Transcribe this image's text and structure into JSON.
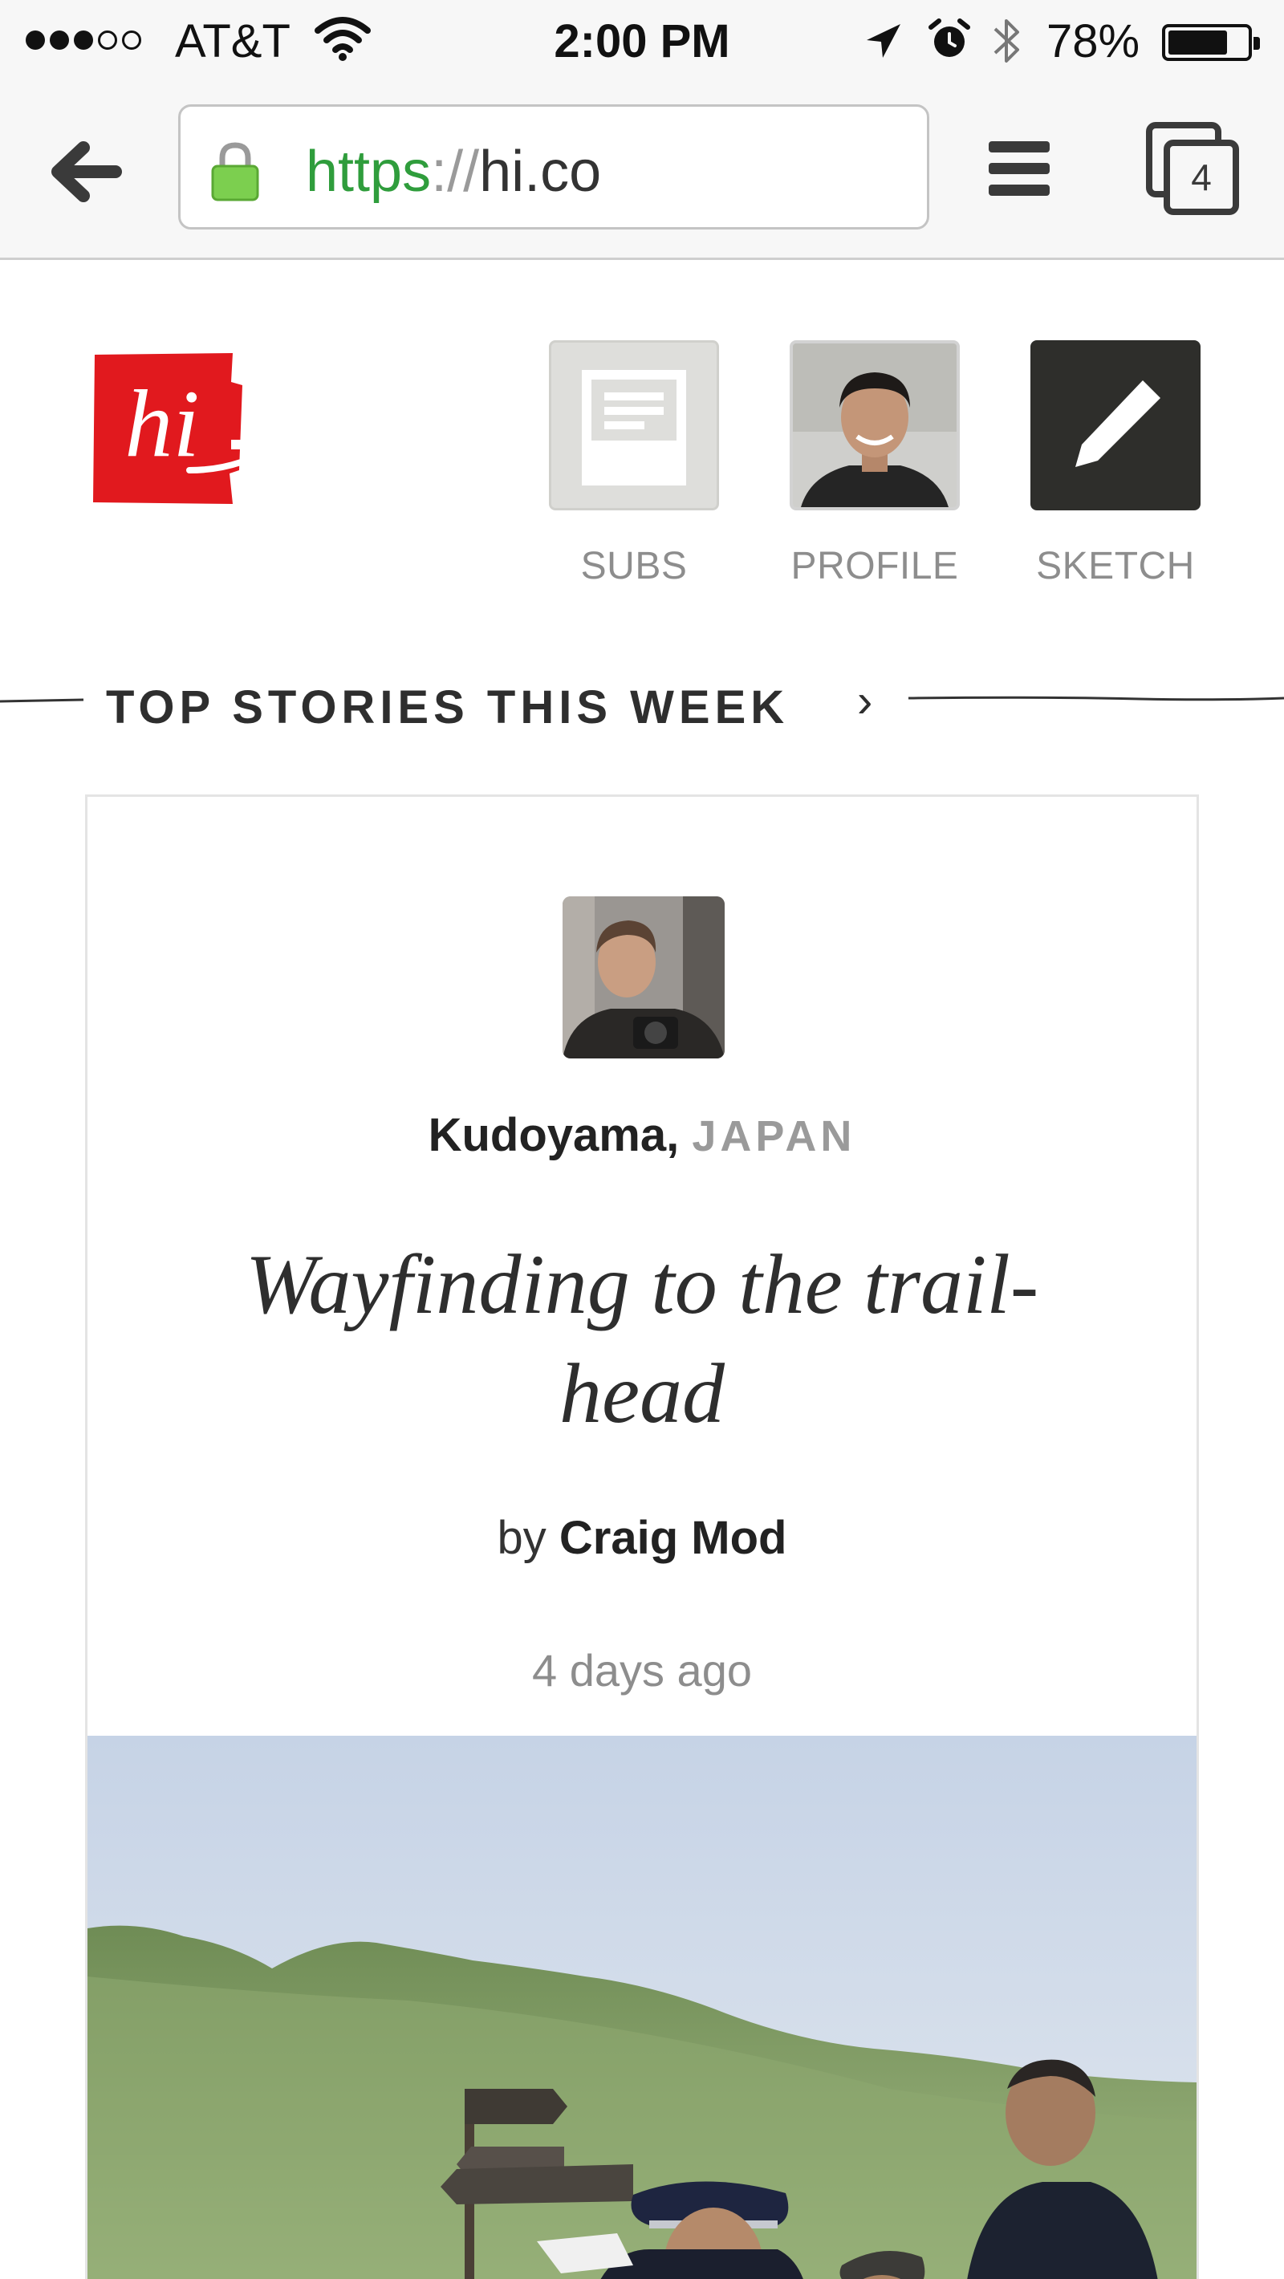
{
  "status_bar": {
    "carrier": "AT&T",
    "time": "2:00 PM",
    "battery_percent": "78%",
    "battery_level": 0.78,
    "signal_bars_filled": 3,
    "signal_bars_total": 5
  },
  "browser": {
    "url_scheme": "https",
    "url_separator": "://",
    "url_host": "hi.co",
    "tab_count": "4",
    "url_scheme_color": "#2f9d3c"
  },
  "header": {
    "logo_text": "hi",
    "logo_color": "#e1191e",
    "nav": [
      {
        "label": "SUBS",
        "icon": "document-icon"
      },
      {
        "label": "PROFILE",
        "icon": "avatar"
      },
      {
        "label": "SKETCH",
        "icon": "pencil-icon"
      }
    ]
  },
  "section": {
    "title": "TOP STORIES THIS WEEK",
    "chevron": "›"
  },
  "story": {
    "location_city": "Kudoyama,",
    "location_country": "JAPAN",
    "title": "Wayfinding to the trail-head",
    "byline_prefix": "by",
    "author": "Craig Mod",
    "time_ago": "4 days ago"
  }
}
